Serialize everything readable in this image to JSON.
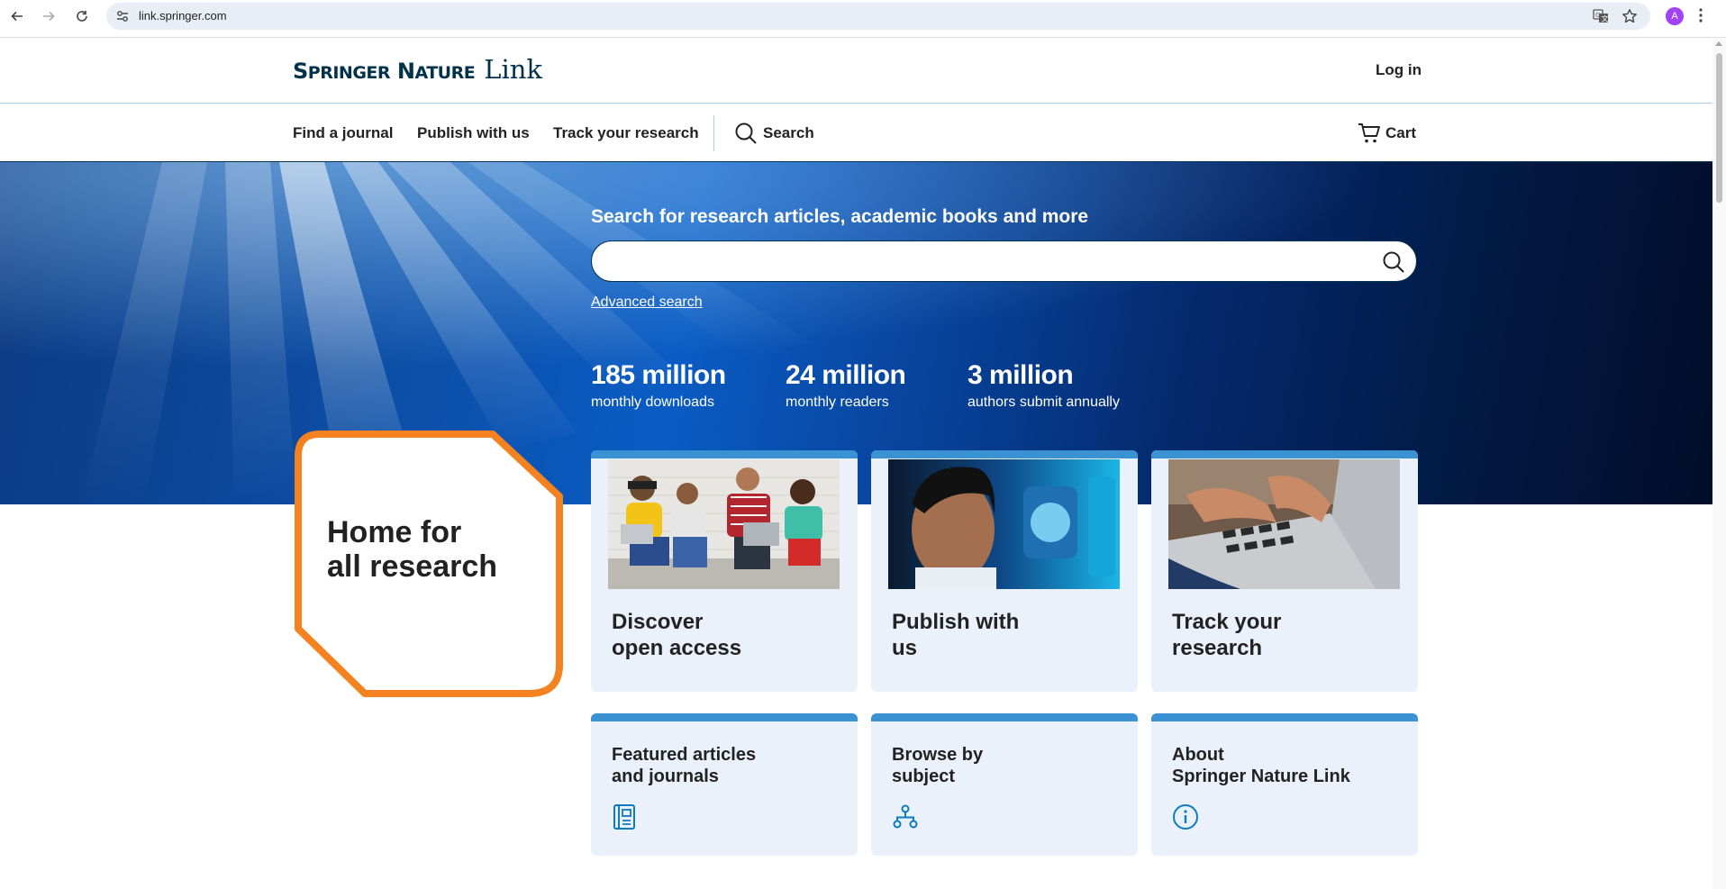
{
  "browser": {
    "url": "link.springer.com",
    "profile_initial": "A"
  },
  "header": {
    "logo_brand_S": "S",
    "logo_brand_pringer": "PRINGER",
    "logo_brand_N": "N",
    "logo_brand_ature": "ATURE",
    "logo_link": "Link",
    "login_label": "Log in"
  },
  "nav": {
    "items": [
      {
        "label": "Find a journal"
      },
      {
        "label": "Publish with us"
      },
      {
        "label": "Track your research"
      }
    ],
    "search_label": "Search",
    "cart_label": "Cart"
  },
  "hero": {
    "title": "Search for research articles, academic books and more",
    "search_value": "",
    "advanced_search": "Advanced search",
    "stats": [
      {
        "number": "185 million",
        "label": "monthly downloads"
      },
      {
        "number": "24 million",
        "label": "monthly readers"
      },
      {
        "number": "3 million",
        "label": "authors submit annually"
      }
    ]
  },
  "home_box": {
    "line1": "Home for",
    "line2": "all research",
    "border_color": "#f58220"
  },
  "cards": [
    {
      "line1": "Discover",
      "line2": "open access"
    },
    {
      "line1": "Publish with",
      "line2": "us"
    },
    {
      "line1": "Track your",
      "line2": "research"
    }
  ],
  "small_cards": [
    {
      "line1": "Featured articles",
      "line2": "and journals",
      "icon": "journal-icon"
    },
    {
      "line1": "Browse by",
      "line2": "subject",
      "icon": "subject-tree-icon"
    },
    {
      "line1": "About",
      "line2": "Springer Nature Link",
      "icon": "info-icon"
    }
  ],
  "colors": {
    "brand_navy": "#01324b",
    "accent_blue": "#3a92d2",
    "card_bg": "#ebf1fb",
    "icon_blue": "#0c7bbf",
    "orange": "#f58220"
  }
}
